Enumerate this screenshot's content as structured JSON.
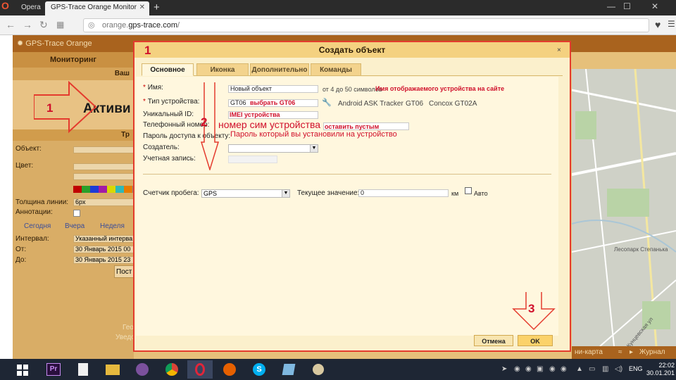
{
  "browser": {
    "tabs": [
      {
        "label": "Opera"
      },
      {
        "label": "GPS-Trace Orange Monitor"
      }
    ],
    "url_host_prefix": "orange.",
    "url_host": "gps-trace.com",
    "url_path": "/"
  },
  "app": {
    "brand": "GPS-Trace Orange",
    "sidebar_tab": "Мониторинг",
    "sidebar_sub": "Ваш",
    "sidebar_active": "Активи",
    "sidebar_section": "Тр",
    "fields": {
      "object": "Объект:",
      "color": "Цвет:",
      "line_width": "Толщина линии:",
      "line_width_value": "6px",
      "annotations": "Аннотации:",
      "interval": "Интервал:",
      "interval_value": "Указанный интерва",
      "from": "От:",
      "from_value": "30 Январь 2015 00",
      "to": "До:",
      "to_value": "30 Январь 2015 23"
    },
    "period_tabs": [
      "Сегодня",
      "Вчера",
      "Неделя"
    ],
    "build_button": "Пост",
    "side_texts": [
      "Гео",
      "Уведо"
    ],
    "map_bottom": [
      "ни-карта",
      "Журнал"
    ],
    "map_labels": [
      "Лесопарк Степанька",
      "Кунцевская ул"
    ],
    "swatch_colors": [
      "#c00000",
      "#2aa02a",
      "#1c3bd6",
      "#a21ca6",
      "#d8d800",
      "#2fb8b8",
      "#e87b00",
      "#888888"
    ]
  },
  "dialog": {
    "title": "Создать объект",
    "close": "×",
    "tabs": [
      "Основное",
      "Иконка",
      "Дополнительно",
      "Команды"
    ],
    "name_label": "Имя:",
    "name_value": "Новый объект",
    "name_hint": "от 4 до 50 символов",
    "name_annot": "Имя отображаемого устройства на сайте",
    "device_type_label": "Тип устройства:",
    "device_type_value": "GT06",
    "device_type_annot": "выбрать GT06",
    "device_suggestions": [
      "Android ASK Tracker",
      "GT06",
      "Concox GT02A"
    ],
    "uid_label": "Уникальный ID:",
    "uid_annot": "IMEI устройства",
    "phone_label": "Телефонный номер:",
    "phone_annot": "номер сим устройства",
    "phone_annot2": "оставить пустым",
    "password_label": "Пароль доступа к объекту:",
    "password_annot": "Пароль который вы установили на устройство",
    "creator_label": "Создатель:",
    "account_label": "Учетная запись:",
    "mileage_label": "Счетчик пробега:",
    "mileage_value": "GPS",
    "current_label": "Текущее значение:",
    "current_value": "0",
    "unit": "км",
    "auto_label": "Авто",
    "cancel": "Отмена",
    "ok": "OK"
  },
  "annotations": {
    "num1": "1",
    "num1b": "1",
    "num2": "2",
    "num3": "3"
  },
  "taskbar": {
    "lang": "ENG",
    "time": "22:02",
    "date": "30.01.201"
  },
  "colors": {
    "accent_red": "#e43b2e",
    "dialog_bg": "#fff7de",
    "header_brown": "#a9631e"
  }
}
